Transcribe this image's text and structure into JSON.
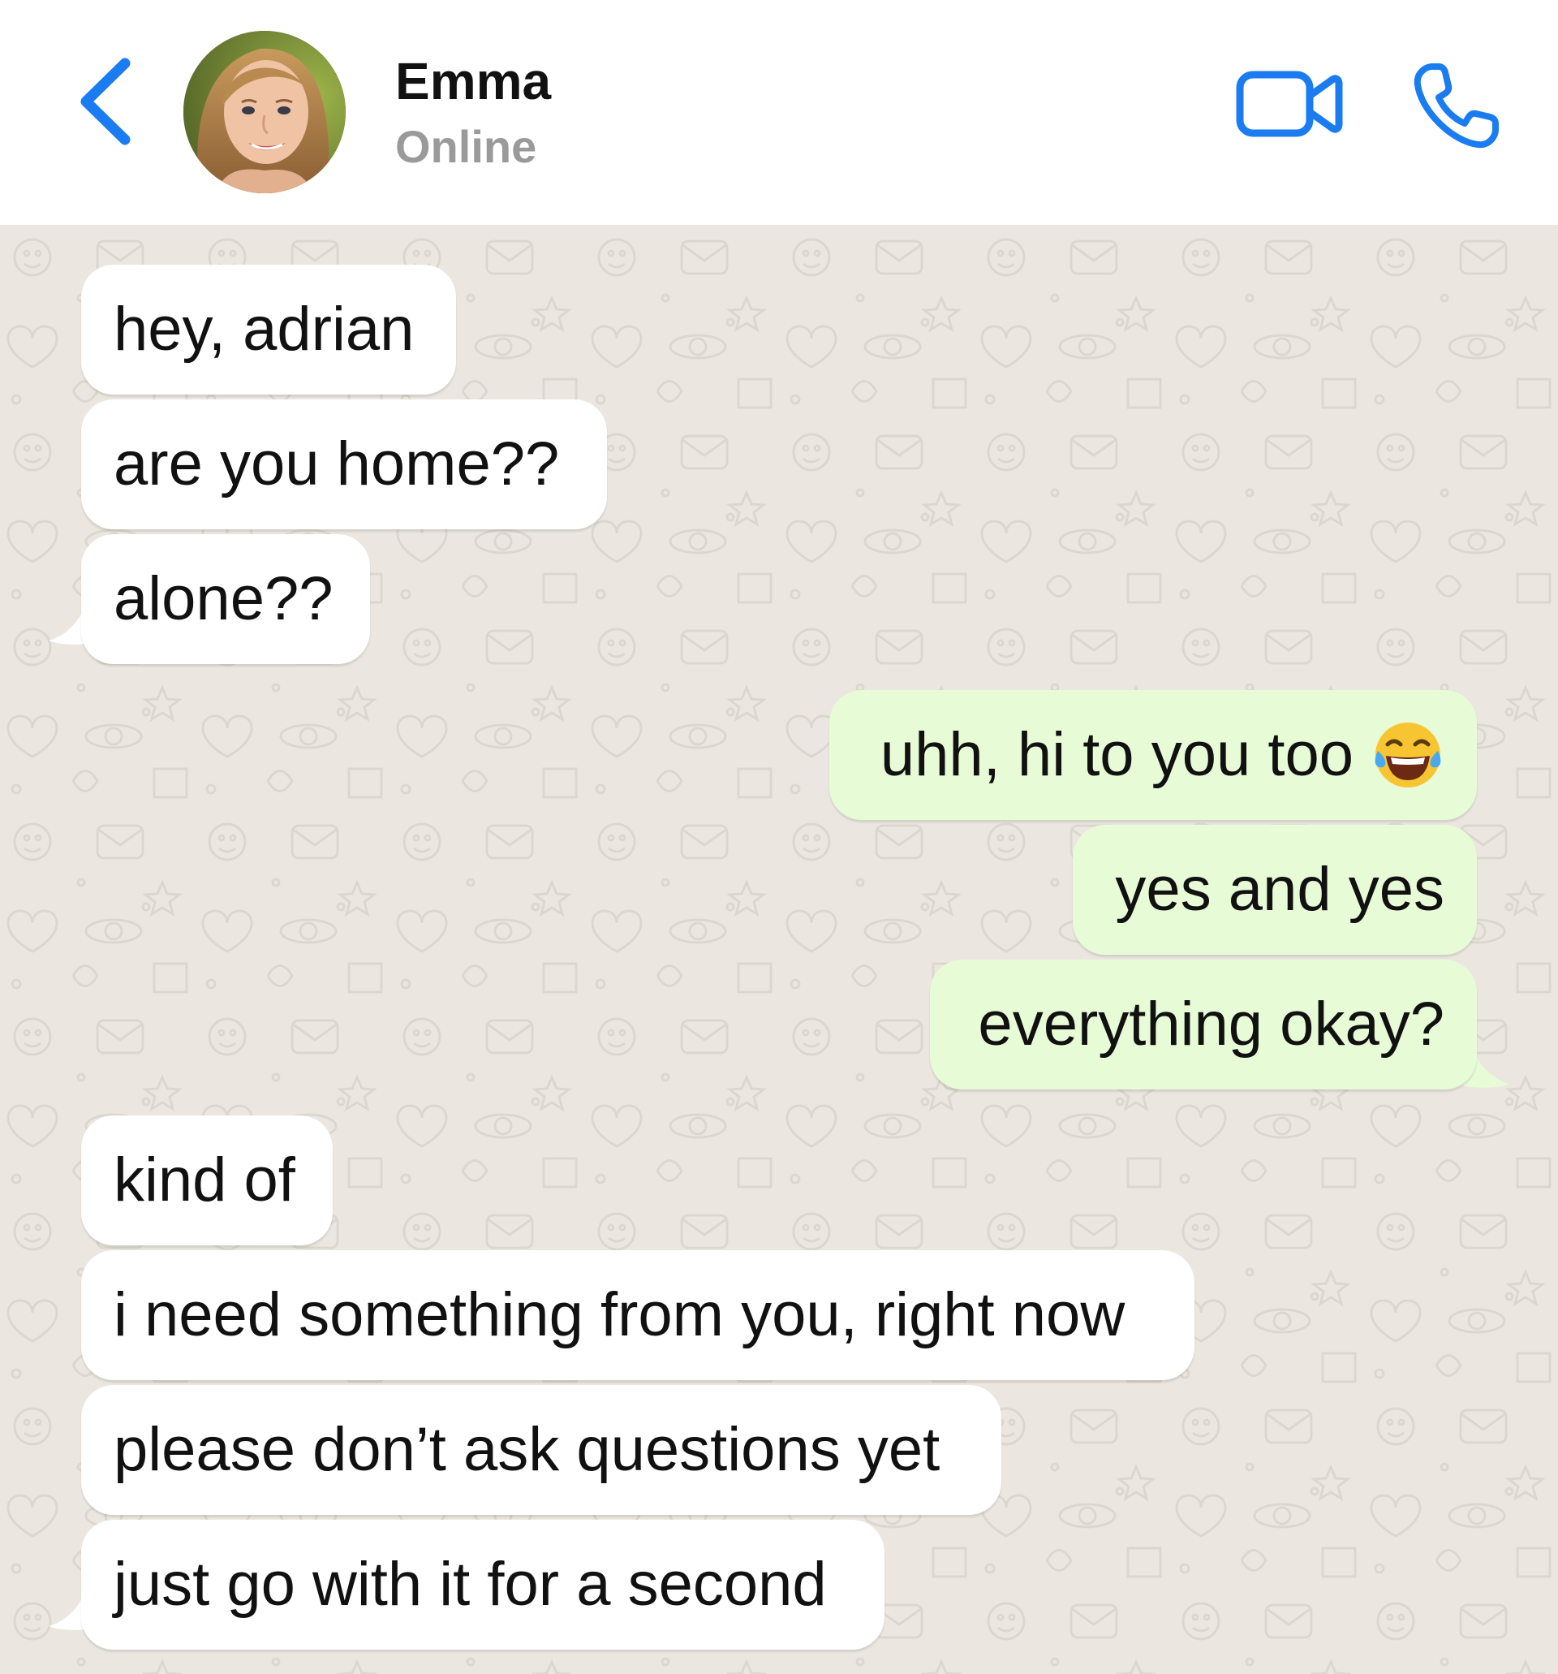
{
  "header": {
    "contact_name": "Emma",
    "contact_status": "Online",
    "icons": {
      "back": "chevron-left-icon",
      "video": "video-camera-icon",
      "call": "phone-icon"
    },
    "accent_color": "#1a7cf0"
  },
  "messages": [
    {
      "direction": "incoming",
      "text": "hey, adrian"
    },
    {
      "direction": "incoming",
      "text": "are you home??"
    },
    {
      "direction": "incoming",
      "text": "alone??"
    },
    {
      "direction": "outgoing",
      "text": "uhh, hi to you too",
      "emoji": "face-with-tears-of-joy"
    },
    {
      "direction": "outgoing",
      "text": "yes and yes"
    },
    {
      "direction": "outgoing",
      "text": "everything okay?"
    },
    {
      "direction": "incoming",
      "text": "kind of"
    },
    {
      "direction": "incoming",
      "text": "i need something from you, right now"
    },
    {
      "direction": "incoming",
      "text": "please don’t ask questions yet"
    },
    {
      "direction": "incoming",
      "text": "just go with it for a second"
    }
  ],
  "colors": {
    "incoming_bubble": "#ffffff",
    "outgoing_bubble": "#e7fbd7",
    "chat_background": "#ebe7e0"
  }
}
